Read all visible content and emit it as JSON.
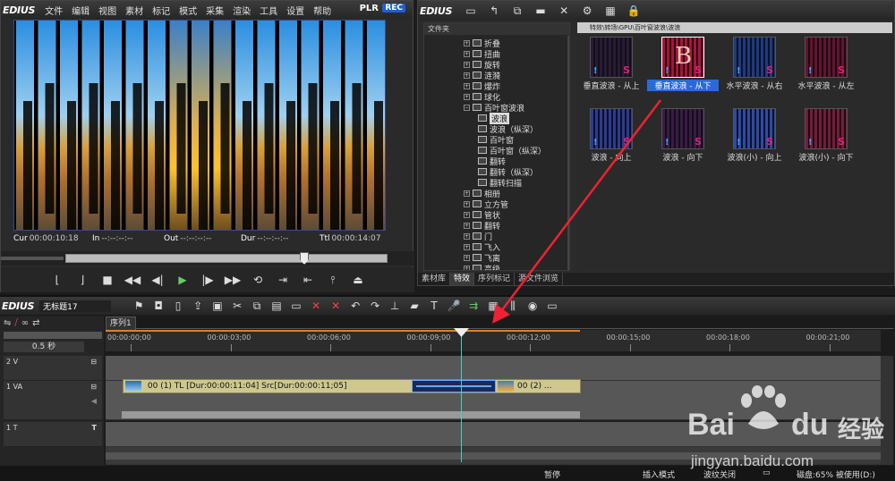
{
  "player": {
    "app_logo": "EDIUS",
    "menu": [
      "文件",
      "编辑",
      "视图",
      "素材",
      "标记",
      "模式",
      "采集",
      "渲染",
      "工具",
      "设置",
      "帮助"
    ],
    "mode_plr": "PLR",
    "mode_rec": "REC",
    "timecodes": {
      "cur_label": "Cur",
      "cur": "00:00:10:18",
      "in_label": "In",
      "in": "--:--:--:--",
      "out_label": "Out",
      "out": "--:--:--:--",
      "dur_label": "Dur",
      "dur": "--:--:--:--",
      "ttl_label": "Ttl",
      "ttl": "00:00:14:07"
    }
  },
  "bin": {
    "app_logo": "EDIUS",
    "folder_header": "文件夹",
    "path": "特效\\转场\\GPU\\百叶窗波浪\\波浪",
    "folders": [
      {
        "label": "折叠",
        "level": 0
      },
      {
        "label": "扭曲",
        "level": 0
      },
      {
        "label": "旋转",
        "level": 0
      },
      {
        "label": "涟漪",
        "level": 0
      },
      {
        "label": "爆炸",
        "level": 0
      },
      {
        "label": "球化",
        "level": 0
      },
      {
        "label": "百叶窗波浪",
        "level": 0,
        "open": true
      },
      {
        "label": "波浪",
        "level": 1,
        "selected": true
      },
      {
        "label": "波浪（纵深）",
        "level": 1
      },
      {
        "label": "百叶窗",
        "level": 1
      },
      {
        "label": "百叶窗（纵深）",
        "level": 1
      },
      {
        "label": "翻转",
        "level": 1
      },
      {
        "label": "翻转（纵深）",
        "level": 1
      },
      {
        "label": "翻转扫描",
        "level": 1
      },
      {
        "label": "相册",
        "level": 0
      },
      {
        "label": "立方管",
        "level": 0
      },
      {
        "label": "管状",
        "level": 0
      },
      {
        "label": "翻转",
        "level": 0
      },
      {
        "label": "门",
        "level": 0
      },
      {
        "label": "飞入",
        "level": 0
      },
      {
        "label": "飞离",
        "level": 0
      },
      {
        "label": "高级",
        "level": 0
      }
    ],
    "thumbnails": [
      {
        "label": "垂直波浪 - 从上",
        "letter": "",
        "bg": "#2a1a3a"
      },
      {
        "label": "垂直波浪 - 从下",
        "letter": "B",
        "bg": "#b0103a",
        "selected": true
      },
      {
        "label": "水平波浪 - 从右",
        "letter": "",
        "bg": "#1a3a8a"
      },
      {
        "label": "水平波浪 - 从左",
        "letter": "",
        "bg": "#6a1030"
      },
      {
        "label": "波浪 - 向上",
        "letter": "",
        "bg": "#2a3a9a"
      },
      {
        "label": "波浪 - 向下",
        "letter": "",
        "bg": "#3a1a4a"
      },
      {
        "label": "波浪(小) - 向上",
        "letter": "",
        "bg": "#2a4ab0"
      },
      {
        "label": "波浪(小) - 向下",
        "letter": "",
        "bg": "#7a1a3a"
      }
    ],
    "tabs": [
      "素材库",
      "特效",
      "序列标记",
      "源文件浏览"
    ],
    "active_tab": "特效"
  },
  "timeline": {
    "app_logo": "EDIUS",
    "project_name": "无标题17",
    "sequence_tab": "序列1",
    "zoom": "0.5 秒",
    "ruler": [
      "00:00:00;00",
      "00:00:03;00",
      "00:00:06;00",
      "00:00:09;00",
      "00:00:12;00",
      "00:00:15;00",
      "00:00:18;00",
      "00:00:21;00"
    ],
    "tracks": [
      {
        "name": "2 V"
      },
      {
        "name": "1 VA"
      },
      {
        "name": "1 T"
      }
    ],
    "clip_left": "00 (1)  TL [Dur:00:00:11:04]  Src[Dur:00:00:11;05]",
    "clip_right": "00 (2)  ..."
  },
  "status": {
    "paused": "暂停",
    "insert_mode": "插入模式",
    "ripple_off": "波纹关闭",
    "disk": "磁盘:65% 被使用(D:)"
  },
  "watermark": {
    "brand": "Bai",
    "brand2": "du",
    "cn": "经验",
    "url": "jingyan.baidu.com"
  }
}
